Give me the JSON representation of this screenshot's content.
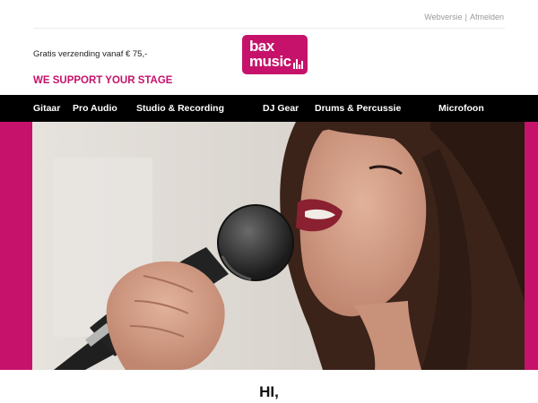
{
  "header": {
    "links": {
      "webversion": "Webversie",
      "separator": "|",
      "unsubscribe": "Afmelden"
    },
    "shipping_text": "Gratis verzending vanaf € 75,-",
    "logo": {
      "line1": "bax",
      "line2": "music"
    },
    "tagline": "WE SUPPORT YOUR STAGE"
  },
  "nav": {
    "items": [
      "Gitaar",
      "Pro Audio",
      "Studio & Recording",
      "DJ Gear",
      "Drums & Percussie",
      "Microfoon"
    ]
  },
  "hero": {
    "image_icon": "singer-with-microphone-photo",
    "accent_color": "#c6126a"
  },
  "greeting": "HI,",
  "colors": {
    "brand": "#c6126a",
    "nav_bg": "#000000"
  }
}
